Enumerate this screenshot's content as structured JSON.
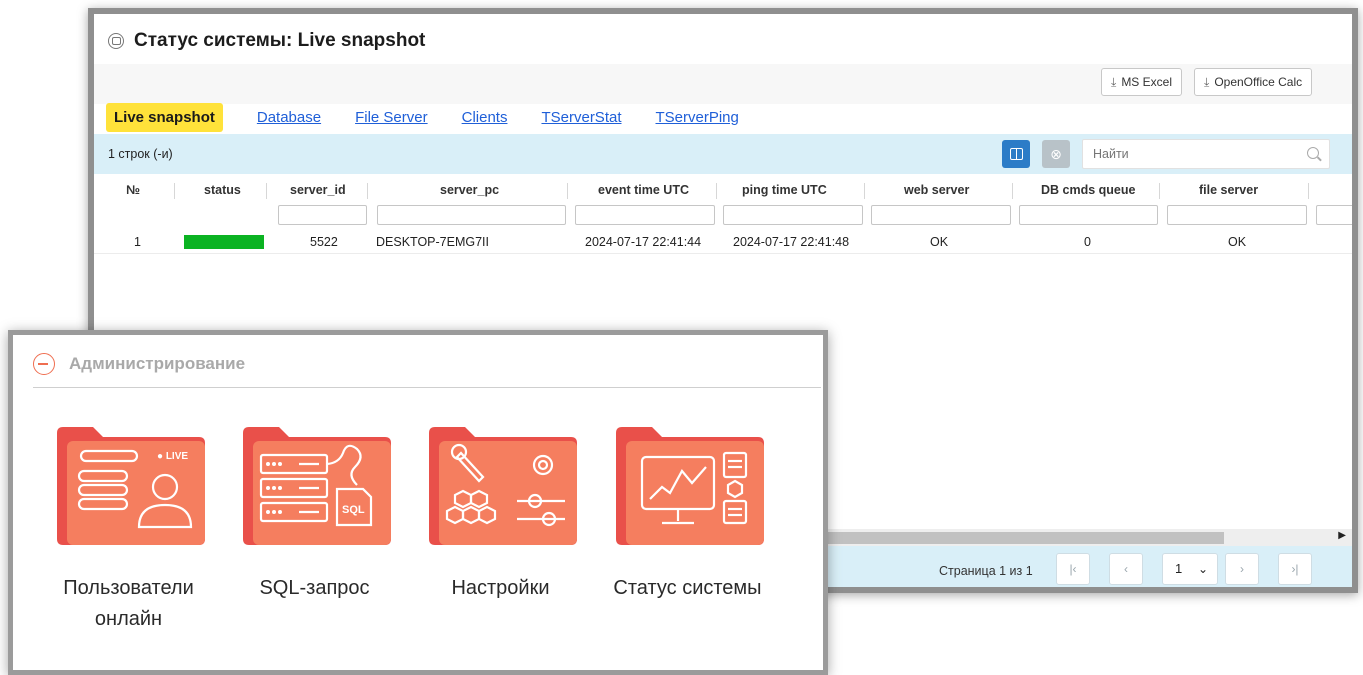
{
  "status_window": {
    "title": "Статус системы: Live snapshot",
    "export": {
      "excel": "MS Excel",
      "calc": "OpenOffice Calc"
    },
    "tabs": [
      {
        "label": "Live snapshot",
        "active": true
      },
      {
        "label": "Database"
      },
      {
        "label": "File Server"
      },
      {
        "label": "Clients"
      },
      {
        "label": "TServerStat"
      },
      {
        "label": "TServerPing"
      }
    ],
    "row_count": "1 строк (-и)",
    "search": {
      "placeholder": "Найти"
    },
    "columns": [
      "№",
      "status",
      "server_id",
      "server_pc",
      "event time UTC",
      "ping time UTC",
      "web server",
      "DB cmds queue",
      "file server"
    ],
    "rows": [
      {
        "num": "1",
        "status_color": "#0bb322",
        "server_id": "5522",
        "server_pc": "DESKTOP-7EMG7II",
        "event_time": "2024-07-17 22:41:44",
        "ping_time": "2024-07-17 22:41:48",
        "web_server": "OK",
        "db_queue": "0",
        "file_server": "OK"
      }
    ],
    "pager": {
      "text": "Страница 1 из 1",
      "first": "|‹",
      "prev": "‹",
      "page": "1",
      "next": "›",
      "last": "›|"
    }
  },
  "admin": {
    "title": "Администрирование",
    "accent": "#f0795a",
    "tiles": [
      {
        "label": "Пользователи онлайн",
        "badge": "● LIVE",
        "icon": "users-online-icon"
      },
      {
        "label": "SQL-запрос",
        "badge": "SQL",
        "icon": "sql-query-icon"
      },
      {
        "label": "Настройки",
        "icon": "settings-icon"
      },
      {
        "label": "Статус системы",
        "icon": "system-status-icon"
      }
    ]
  }
}
